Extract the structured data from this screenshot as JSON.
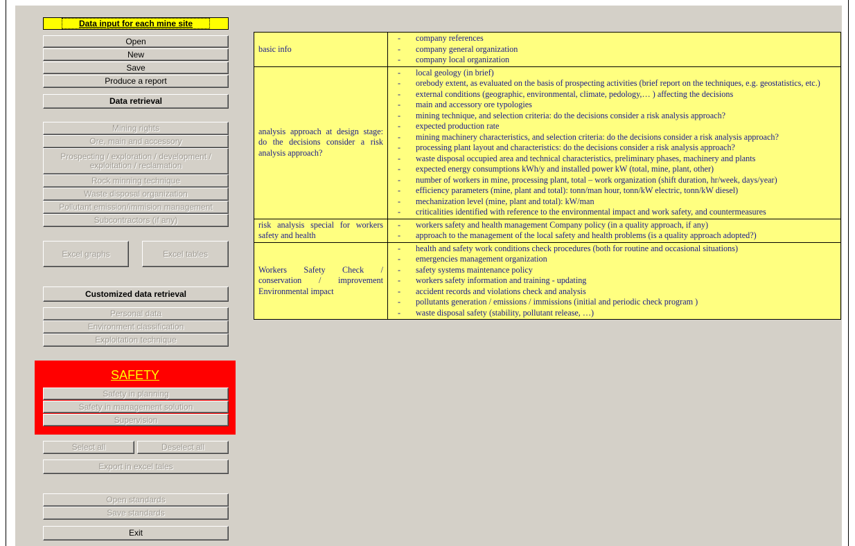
{
  "sidebar": {
    "header_label": "Data input for each mine site",
    "file_buttons": [
      "Open",
      "New",
      "Save",
      "Produce a report"
    ],
    "data_retrieval_label": "Data retrieval",
    "data_retrieval_items": [
      "Mining rights",
      "Ore, main and accessory",
      "Prospecting / exploration / development / exploitation / reclamation",
      "Rock minning technique",
      "Waste disposal organization",
      "Pollutant emission/immision management",
      "Subcontractors (if any)"
    ],
    "excel_graphs_label": "Excel graphs",
    "excel_tables_label": "Excel tables",
    "customized_label": "Customized data retrieval",
    "customized_items": [
      "Personal data",
      "Environment classification",
      "Exploitation technique"
    ],
    "safety_title": "SAFETY",
    "safety_items": [
      "Safety in planning",
      "Safety in management solution",
      "Supervision"
    ],
    "select_all_label": "Select all",
    "deselect_all_label": "Deselect all",
    "export_label": "Export  in excel tales",
    "open_standards_label": "Open standards",
    "save_standards_label": "Save standards",
    "exit_label": "Exit"
  },
  "colors": {
    "panel": "#d4d0c8",
    "header_yellow": "#ffff00",
    "safety_red": "#ff0000",
    "table_bg": "#ffff80",
    "table_text": "#1a1a8c"
  },
  "table": {
    "rows": [
      {
        "label": "basic info",
        "items": [
          "company references",
          "company general organization",
          "company local organization"
        ]
      },
      {
        "label": "analysis approach at design stage: do the decisions consider a risk analysis approach?",
        "items": [
          "local geology (in brief)",
          "orebody extent, as evaluated on the basis of prospecting activities (brief report on the techniques, e.g. geostatistics, etc.)",
          "external conditions (geographic, environmental, climate, pedology,… ) affecting the decisions",
          "main and accessory ore typologies",
          "mining technique, and selection criteria: do the decisions consider a risk analysis approach?",
          "expected production rate",
          "mining machinery characteristics, and selection criteria: do the decisions consider a risk analysis approach?",
          "processing plant layout and characteristics: do the decisions consider a risk analysis approach?",
          "waste disposal occupied area and technical characteristics, preliminary phases, machinery and plants",
          "expected energy consumptions kWh/y and installed power kW (total, mine, plant, other)",
          "number of workers in mine, processing plant, total – work organization (shift duration, hr/week, days/year)",
          "efficiency parameters (mine, plant and total): tonn/man hour, tonn/kW electric, tonn/kW diesel)",
          "mechanization level (mine, plant and total): kW/man",
          "criticalities identified with reference to the environmental impact and work safety, and countermeasures"
        ]
      },
      {
        "label": "risk analysis special for workers safety and health",
        "items": [
          "workers safety and health management Company policy (in a quality approach, if any)",
          "approach to the management of the local safety and health problems (is a quality approach adopted?)"
        ]
      },
      {
        "label": "Workers Safety Check / conservation / improvement Environmental impact",
        "items": [
          "health and safety work conditions check procedures (both for routine and occasional situations)",
          "emergencies management organization",
          "safety systems maintenance policy",
          "workers safety information and training - updating",
          "accident records and violations check and analysis",
          "pollutants generation / emissions / immissions (initial and periodic check program )",
          "waste disposal safety (stability, pollutant release, …)"
        ]
      }
    ]
  }
}
